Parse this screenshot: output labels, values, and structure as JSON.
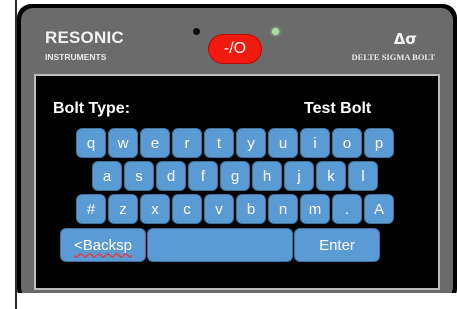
{
  "device": {
    "brand": "RESONIC",
    "brand_sub": "INSTRUMENTS",
    "symbol": "Δσ",
    "model": "DELTE SIGMA BOLT",
    "power_label": "-/O",
    "led_left": "off",
    "led_right": "on"
  },
  "screen": {
    "field_label": "Bolt Type:",
    "field_value": "Test Bolt"
  },
  "keyboard": {
    "row1": [
      "q",
      "w",
      "e",
      "r",
      "t",
      "y",
      "u",
      "i",
      "o",
      "p"
    ],
    "row2": [
      "a",
      "s",
      "d",
      "f",
      "g",
      "h",
      "j",
      "k",
      "l"
    ],
    "row3": [
      "#",
      "z",
      "x",
      "c",
      "v",
      "b",
      "n",
      "m",
      ".",
      "A"
    ],
    "backspace": "<Backsp",
    "space": "",
    "enter": "Enter"
  },
  "colors": {
    "key": "#5b9bd5",
    "power": "#f21a0e",
    "bezel": "#6b6b6b",
    "led_on": "#a9e0a0"
  }
}
